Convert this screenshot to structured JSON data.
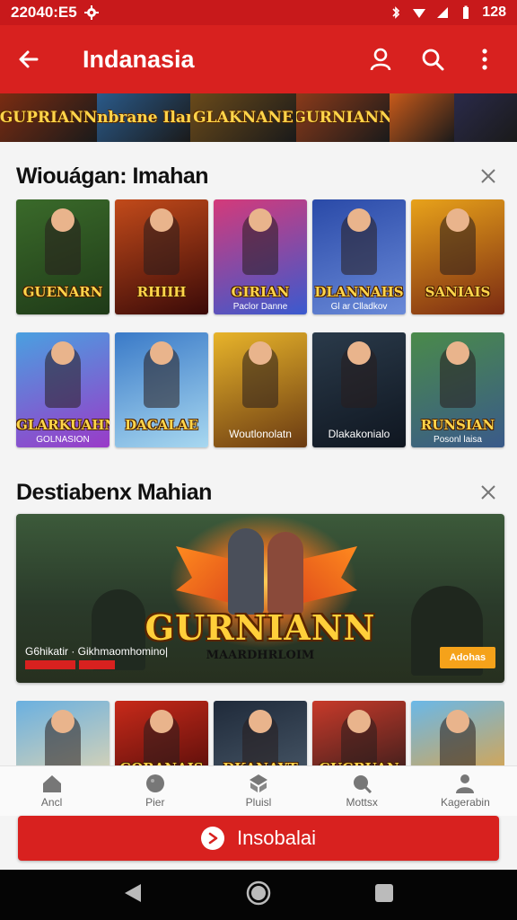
{
  "status_bar": {
    "time": "22040:E5",
    "right_text": "128"
  },
  "app_bar": {
    "title": "Indanasia"
  },
  "banner": {
    "tiles": [
      {
        "label": "GUPRIANN",
        "bg": "#7a2c12"
      },
      {
        "label": "Uoanbrane Ilanian",
        "bg": "#2a5a8a"
      },
      {
        "label": "GLAKNANE",
        "bg": "#6a4a1a"
      },
      {
        "label": "GURNIANN",
        "bg": "#8a3a1a"
      },
      {
        "label": "",
        "bg": "#c85a1a"
      },
      {
        "label": "",
        "bg": "#2a2a4a"
      }
    ]
  },
  "section1": {
    "title": "Wiouágan: Imahan",
    "row1": [
      {
        "label": "GUENARN",
        "sub": "",
        "bg1": "#3a6a2a",
        "bg2": "#1f3a18",
        "badge": ""
      },
      {
        "label": "RHIIH",
        "sub": "",
        "bg1": "#c24a1a",
        "bg2": "#3a0a08",
        "badge": ""
      },
      {
        "label": "GIRIAN",
        "sub": "Paclor Danne",
        "bg1": "#d43a7a",
        "bg2": "#3a5acf",
        "badge": ""
      },
      {
        "label": "DLANNAHS",
        "sub": "Gl ar Clladkov",
        "bg1": "#2a4aa8",
        "bg2": "#6a8ad8",
        "badge": ""
      },
      {
        "label": "SANIAIS",
        "sub": "",
        "bg1": "#e8a21a",
        "bg2": "#7a2a12",
        "badge": ""
      }
    ],
    "row2": [
      {
        "label": "GLARKUAHN",
        "sub": "GOLNASION",
        "bg1": "#4aa0e0",
        "bg2": "#9a3ac8",
        "badge": ""
      },
      {
        "label": "DACALAE",
        "sub": "",
        "bg1": "#3a7ac8",
        "bg2": "#a8d8f0",
        "badge": ""
      },
      {
        "label": "",
        "sub": "Woutlonolatn",
        "bg1": "#e8b42a",
        "bg2": "#6a3a12",
        "badge": ""
      },
      {
        "label": "",
        "sub": "Dlakakonialo",
        "bg1": "#2a3a4a",
        "bg2": "#0f1620",
        "badge": ""
      },
      {
        "label": "RUNSIAN",
        "sub": "Posonl laisa",
        "bg1": "#4a8a4a",
        "bg2": "#3a5a8a",
        "badge": ""
      }
    ]
  },
  "section2": {
    "title": "Destiabenx Mahian",
    "featured": {
      "title": "GURNIANN",
      "subtitle": "MAARDHRLOIM",
      "caption": "G6hikatir · Gikhmaomhomino|",
      "tag1": "",
      "tag2": "",
      "button": "Adohas"
    },
    "row3": [
      {
        "label": "",
        "bg1": "#6ab0e0",
        "bg2": "#e8d8b0"
      },
      {
        "label": "GORANAIS",
        "bg1": "#c82a1a",
        "bg2": "#4a0a08"
      },
      {
        "label": "DKANAYT",
        "bg1": "#1f2a3a",
        "bg2": "#4a5a6a"
      },
      {
        "label": "GUGBUAN",
        "bg1": "#c83a2a",
        "bg2": "#2a1a1a"
      },
      {
        "label": "",
        "bg1": "#6ab8e8",
        "bg2": "#e8a23a"
      }
    ]
  },
  "bottom_nav": [
    {
      "label": "Ancl"
    },
    {
      "label": "Pier"
    },
    {
      "label": "Pluisl"
    },
    {
      "label": "Mottsx"
    },
    {
      "label": "Kagerabin"
    }
  ],
  "cta": {
    "label": "Insobalai"
  },
  "colors": {
    "accent": "#d8211f",
    "status": "#c8191b"
  }
}
